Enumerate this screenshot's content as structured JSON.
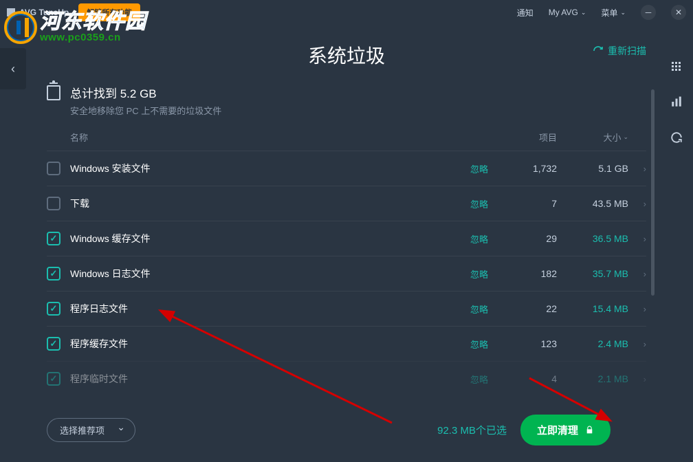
{
  "top": {
    "app_name": "AVG TuneUp",
    "unlock": "解锁所有功能",
    "notify": "通知",
    "myavg": "My AVG",
    "menu": "菜单"
  },
  "watermark": {
    "cn": "河东软件园",
    "url": "www.pc0359.cn"
  },
  "page": {
    "title": "系统垃圾",
    "rescan": "重新扫描"
  },
  "summary": {
    "title": "总计找到 5.2 GB",
    "sub": "安全地移除您 PC 上不需要的垃圾文件"
  },
  "headers": {
    "name": "名称",
    "items": "项目",
    "size": "大小"
  },
  "rows": [
    {
      "checked": false,
      "name": "Windows 安装文件",
      "ignore": "忽略",
      "items": "1,732",
      "size": "5.1 GB",
      "sel": false
    },
    {
      "checked": false,
      "name": "下载",
      "ignore": "忽略",
      "items": "7",
      "size": "43.5 MB",
      "sel": false
    },
    {
      "checked": true,
      "name": "Windows 缓存文件",
      "ignore": "忽略",
      "items": "29",
      "size": "36.5 MB",
      "sel": true
    },
    {
      "checked": true,
      "name": "Windows 日志文件",
      "ignore": "忽略",
      "items": "182",
      "size": "35.7 MB",
      "sel": true
    },
    {
      "checked": true,
      "name": "程序日志文件",
      "ignore": "忽略",
      "items": "22",
      "size": "15.4 MB",
      "sel": true
    },
    {
      "checked": true,
      "name": "程序缓存文件",
      "ignore": "忽略",
      "items": "123",
      "size": "2.4 MB",
      "sel": true
    },
    {
      "checked": true,
      "name": "程序临时文件",
      "ignore": "忽略",
      "items": "4",
      "size": "2.1 MB",
      "sel": true
    }
  ],
  "footer": {
    "select_dd": "选择推荐项",
    "selected": "92.3 MB个已选",
    "clean": "立即清理"
  }
}
